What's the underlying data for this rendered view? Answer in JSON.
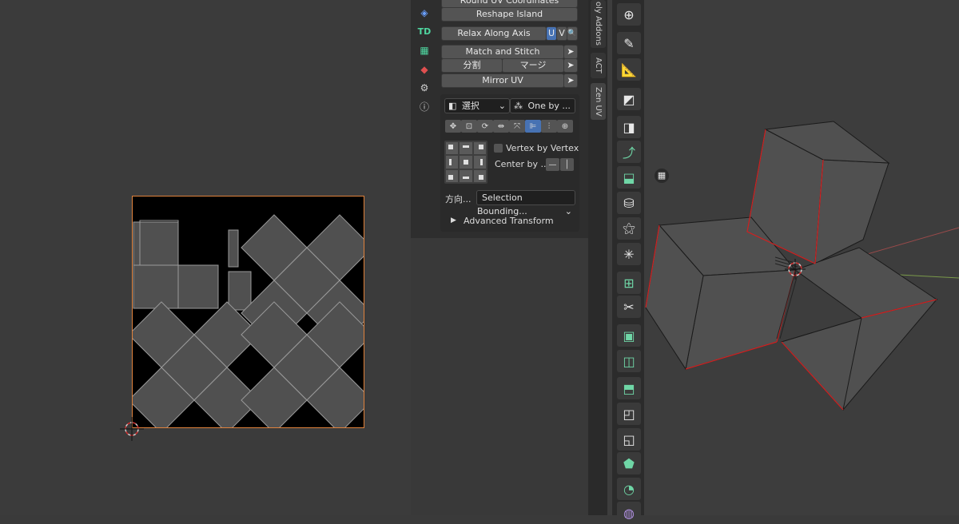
{
  "panel": {
    "round_uv_label": "Round UV Coordinates",
    "reshape_label": "Reshape Island",
    "relax_label": "Relax Along Axis",
    "relax_u": "U",
    "relax_v": "V",
    "match_stitch_label": "Match and Stitch",
    "split_label": "分割",
    "merge_label": "マージ",
    "mirror_label": "Mirror UV",
    "select_mode_label": "選択",
    "one_by_label": "One by ...",
    "vertex_by_vertex_label": "Vertex by Vertex",
    "center_by_label": "Center by ...",
    "direction_label": "方向...",
    "selection_bounding_label": "Selection Bounding...",
    "advanced_transform_label": "Advanced Transform"
  },
  "left_tool_icons": [
    "layers-icon",
    "td-icon",
    "checker-icon",
    "cube-paint-icon",
    "gear-icon",
    "help-icon"
  ],
  "td_text": "TD",
  "side_tabs": [
    "oly Addons",
    "ACT",
    "Zen UV"
  ],
  "tools": [
    "transform-icon",
    "annotate-icon",
    "measure-icon",
    "add-cube-icon",
    "extrude-icon",
    "inset-icon",
    "bevel-icon",
    "loop-cut-icon",
    "knife-icon",
    "poly-build-icon",
    "spin-icon",
    "smooth-icon",
    "edge-slide-icon",
    "shrink-icon",
    "shear-icon",
    "rip-icon"
  ],
  "colors": {
    "accent": "#4772b3",
    "uv_border": "#e0823c",
    "seam_red": "#d02020",
    "green_icon": "#6fd6a6"
  }
}
